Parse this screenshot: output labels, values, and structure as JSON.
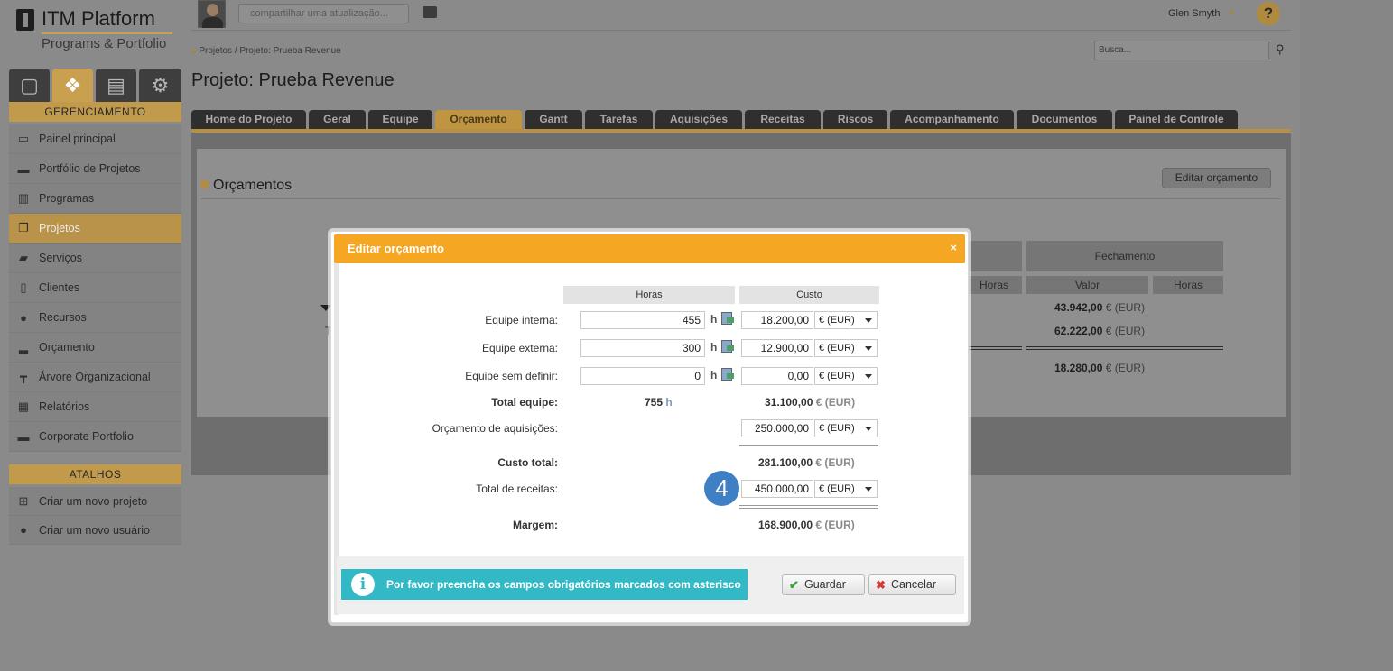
{
  "app": {
    "logo_title": "ITM Platform",
    "logo_subtitle": "Programs & Portfolio"
  },
  "sidebar": {
    "tab_icons": [
      "calendar-icon",
      "cubes-icon",
      "clipboard-icon",
      "gears-icon"
    ],
    "section_management": "GERENCIAMENTO",
    "items": [
      {
        "label": "Painel principal",
        "icon": "presentation-icon"
      },
      {
        "label": "Portfólio de Projetos",
        "icon": "briefcase-icon"
      },
      {
        "label": "Programas",
        "icon": "chart-doc-icon"
      },
      {
        "label": "Projetos",
        "icon": "documents-icon"
      },
      {
        "label": "Serviços",
        "icon": "services-icon"
      },
      {
        "label": "Clientes",
        "icon": "contacts-icon"
      },
      {
        "label": "Recursos",
        "icon": "person-icon"
      },
      {
        "label": "Orçamento",
        "icon": "budget-bars-icon"
      },
      {
        "label": "Árvore Organizacional",
        "icon": "org-tree-icon"
      },
      {
        "label": "Relatórios",
        "icon": "report-icon"
      },
      {
        "label": "Corporate Portfolio",
        "icon": "briefcase-icon"
      }
    ],
    "section_shortcuts": "ATALHOS",
    "shortcuts": [
      {
        "label": "Criar um novo projeto",
        "icon": "new-project-icon"
      },
      {
        "label": "Criar um novo usuário",
        "icon": "new-user-icon"
      }
    ]
  },
  "topbar": {
    "share_placeholder": "compartilhar uma atualização...",
    "user_name": "Glen Smyth",
    "help_label": "?"
  },
  "breadcrumb": "Projetos / Projeto: Prueba Revenue",
  "search": {
    "placeholder": "Busca..."
  },
  "page_title": "Projeto: Prueba Revenue",
  "tabs": [
    "Home do Projeto",
    "Geral",
    "Equipe",
    "Orçamento",
    "Gantt",
    "Tarefas",
    "Aquisições",
    "Receitas",
    "Riscos",
    "Acompanhamento",
    "Documentos",
    "Painel de Controle"
  ],
  "panel": {
    "title": "Orçamentos",
    "edit_button": "Editar orçamento",
    "closing_header": "Fechamento",
    "col_hours": "Horas",
    "col_value": "Valor",
    "closing_values": [
      "43.942,00",
      "62.222,00",
      "18.280,00"
    ],
    "currency_suffix": "€ (EUR)",
    "row_mark": "T"
  },
  "modal": {
    "title": "Editar orçamento",
    "close": "×",
    "col_hours": "Horas",
    "col_cost": "Custo",
    "hour_unit": "h",
    "currency_option": "€ (EUR)",
    "rows": [
      {
        "label": "Equipe interna:",
        "hours": "455",
        "cost": "18.200,00"
      },
      {
        "label": "Equipe externa:",
        "hours": "300",
        "cost": "12.900,00"
      },
      {
        "label": "Equipe sem definir:",
        "hours": "0",
        "cost": "0,00"
      }
    ],
    "team_total_label": "Total equipe:",
    "team_total_hours": "755",
    "team_total_cost": "31.100,00",
    "procurement_label": "Orçamento de aquisições:",
    "procurement_value": "250.000,00",
    "total_cost_label": "Custo total:",
    "total_cost_value": "281.100,00",
    "revenue_label": "Total de receitas:",
    "revenue_value": "450.000,00",
    "margin_label": "Margem:",
    "margin_value": "168.900,00",
    "currency_suffix": "€ (EUR)",
    "step_badge": "4",
    "info_message": "Por favor preencha os campos obrigatórios marcados com asterisco",
    "save_button": "Guardar",
    "cancel_button": "Cancelar"
  },
  "colors": {
    "accent_orange": "#f5a623",
    "info_teal": "#33b9c6",
    "badge_blue": "#3f7fc4",
    "gold": "#c9a050"
  }
}
